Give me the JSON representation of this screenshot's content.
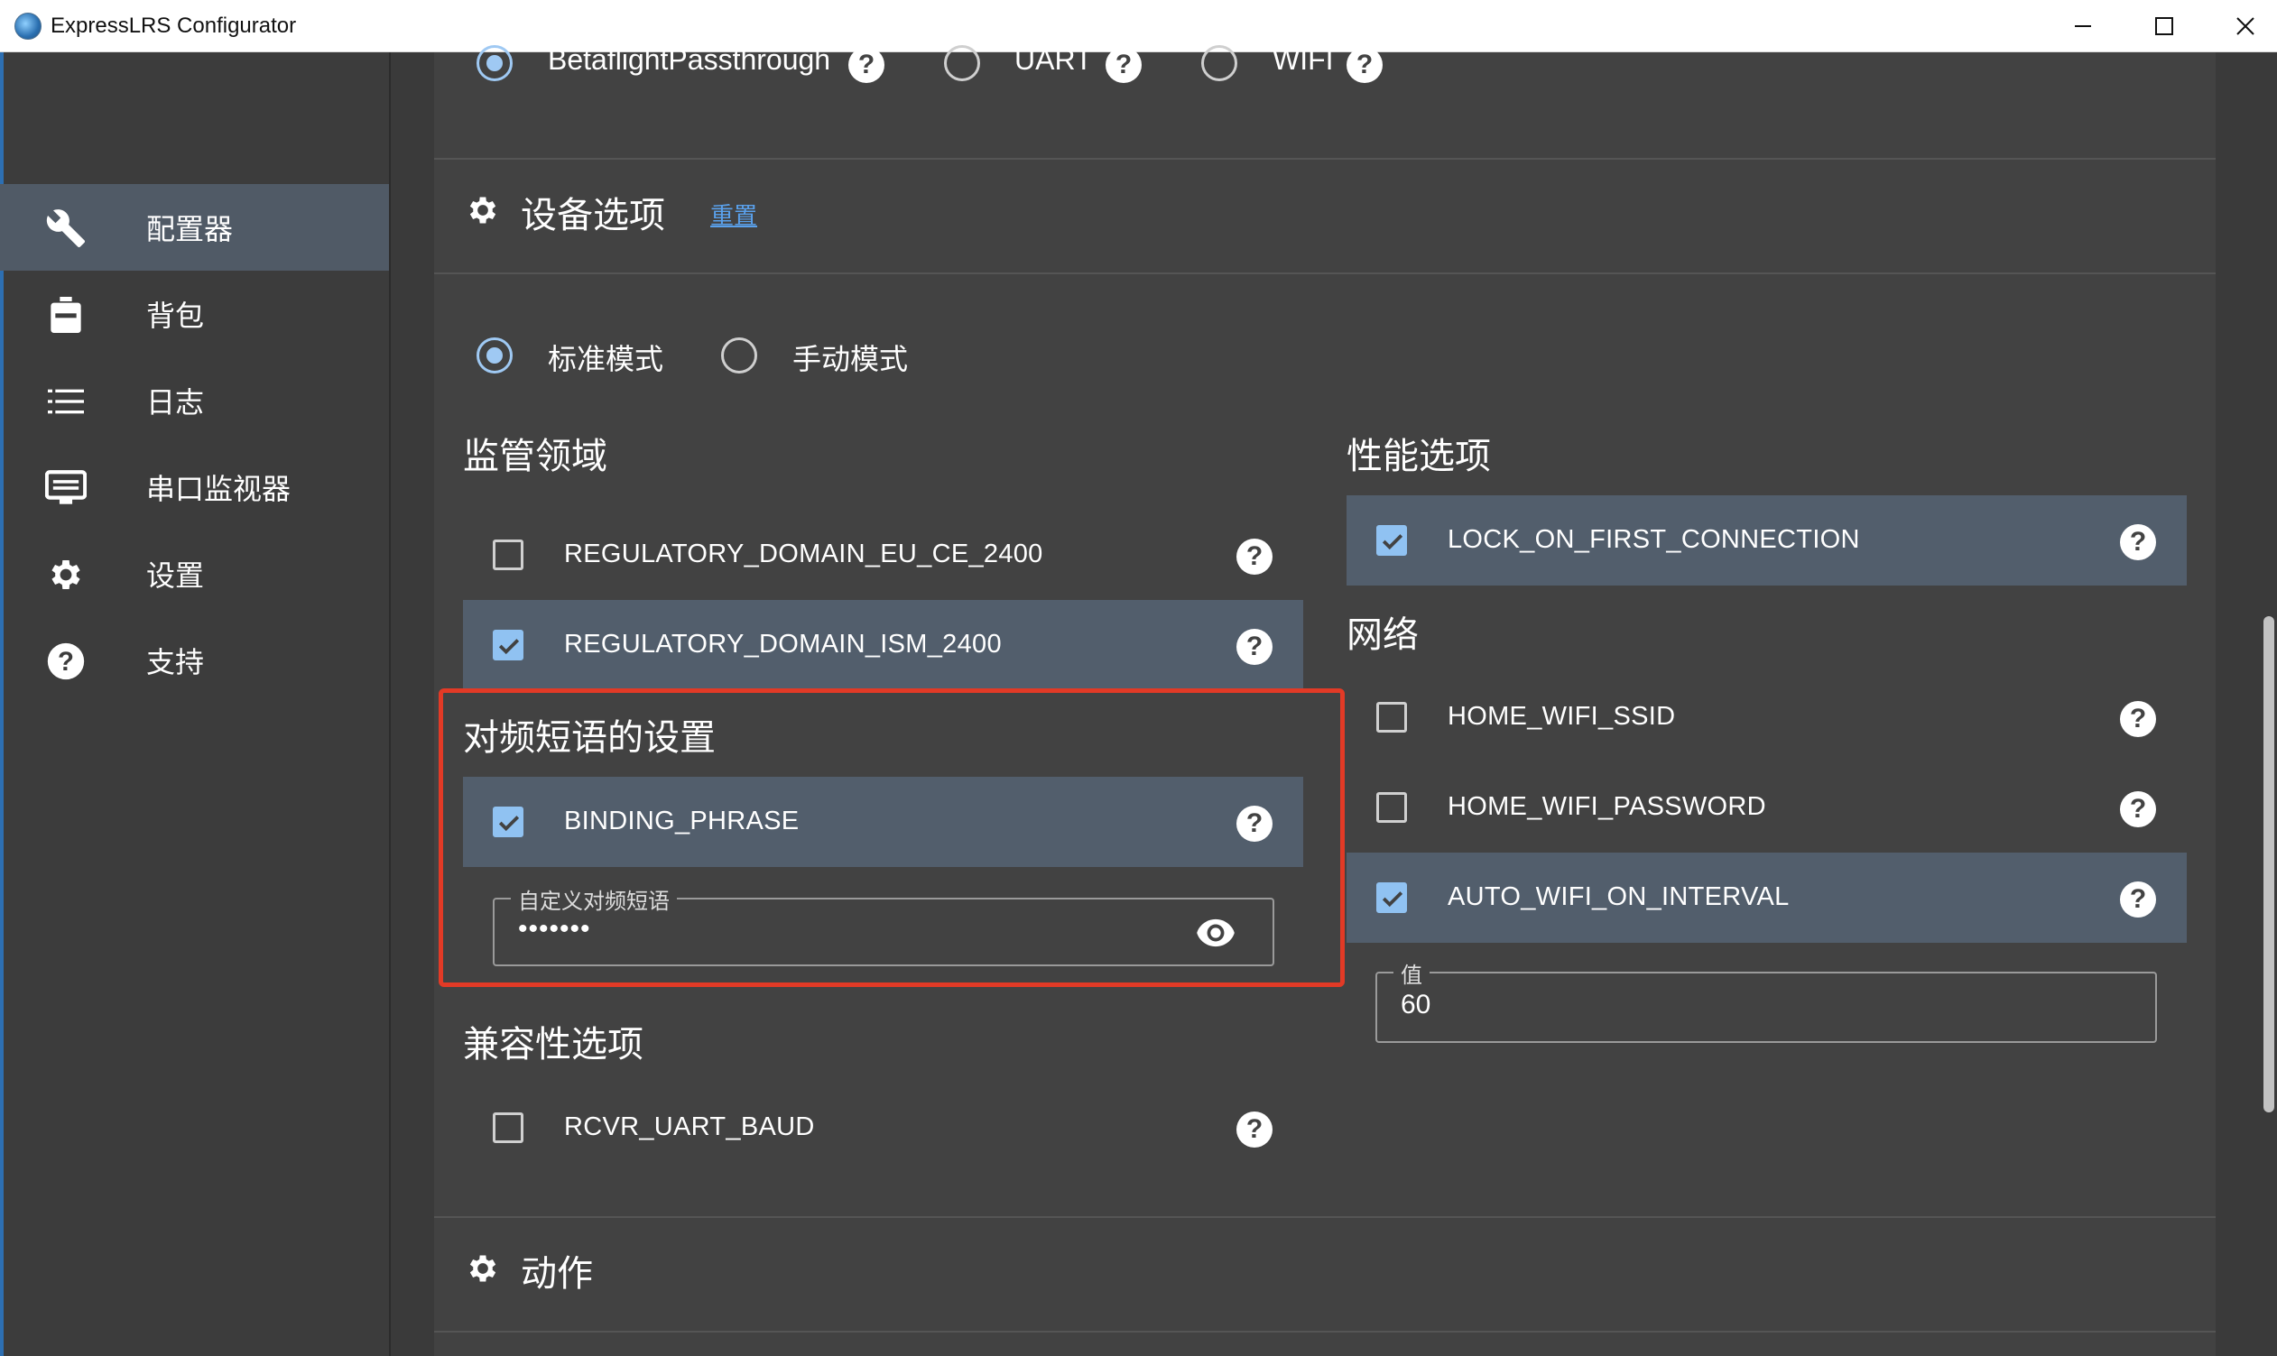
{
  "window": {
    "title": "ExpressLRS Configurator"
  },
  "sidebar": {
    "items": [
      {
        "label": "配置器",
        "icon": "wrench-icon",
        "active": true
      },
      {
        "label": "背包",
        "icon": "backpack-icon",
        "active": false
      },
      {
        "label": "日志",
        "icon": "list-icon",
        "active": false
      },
      {
        "label": "串口监视器",
        "icon": "monitor-icon",
        "active": false
      },
      {
        "label": "设置",
        "icon": "gear-icon",
        "active": false
      },
      {
        "label": "支持",
        "icon": "help-icon",
        "active": false
      }
    ]
  },
  "flashing": {
    "methods": [
      {
        "label": "BetaflightPassthrough",
        "selected": true
      },
      {
        "label": "UART",
        "selected": false
      },
      {
        "label": "WIFI",
        "selected": false
      }
    ]
  },
  "device_options": {
    "title": "设备选项",
    "reset_link": "重置",
    "modes": [
      {
        "label": "标准模式",
        "selected": true
      },
      {
        "label": "手动模式",
        "selected": false
      }
    ],
    "regulatory": {
      "title": "监管领域",
      "items": [
        {
          "label": "REGULATORY_DOMAIN_EU_CE_2400",
          "checked": false
        },
        {
          "label": "REGULATORY_DOMAIN_ISM_2400",
          "checked": true
        }
      ]
    },
    "binding": {
      "title": "对频短语的设置",
      "item": {
        "label": "BINDING_PHRASE",
        "checked": true
      },
      "field_label": "自定义对频短语",
      "field_value": "•••••••"
    },
    "compat": {
      "title": "兼容性选项",
      "items": [
        {
          "label": "RCVR_UART_BAUD",
          "checked": false
        }
      ]
    },
    "performance": {
      "title": "性能选项",
      "items": [
        {
          "label": "LOCK_ON_FIRST_CONNECTION",
          "checked": true
        }
      ]
    },
    "network": {
      "title": "网络",
      "items": [
        {
          "label": "HOME_WIFI_SSID",
          "checked": false
        },
        {
          "label": "HOME_WIFI_PASSWORD",
          "checked": false
        },
        {
          "label": "AUTO_WIFI_ON_INTERVAL",
          "checked": true
        }
      ],
      "value_label": "值",
      "value": "60"
    }
  },
  "actions": {
    "title": "动作"
  },
  "colors": {
    "accent": "#90c2f2",
    "highlight": "#e23a26",
    "panel": "#424242",
    "selected_row": "#525e6c"
  }
}
